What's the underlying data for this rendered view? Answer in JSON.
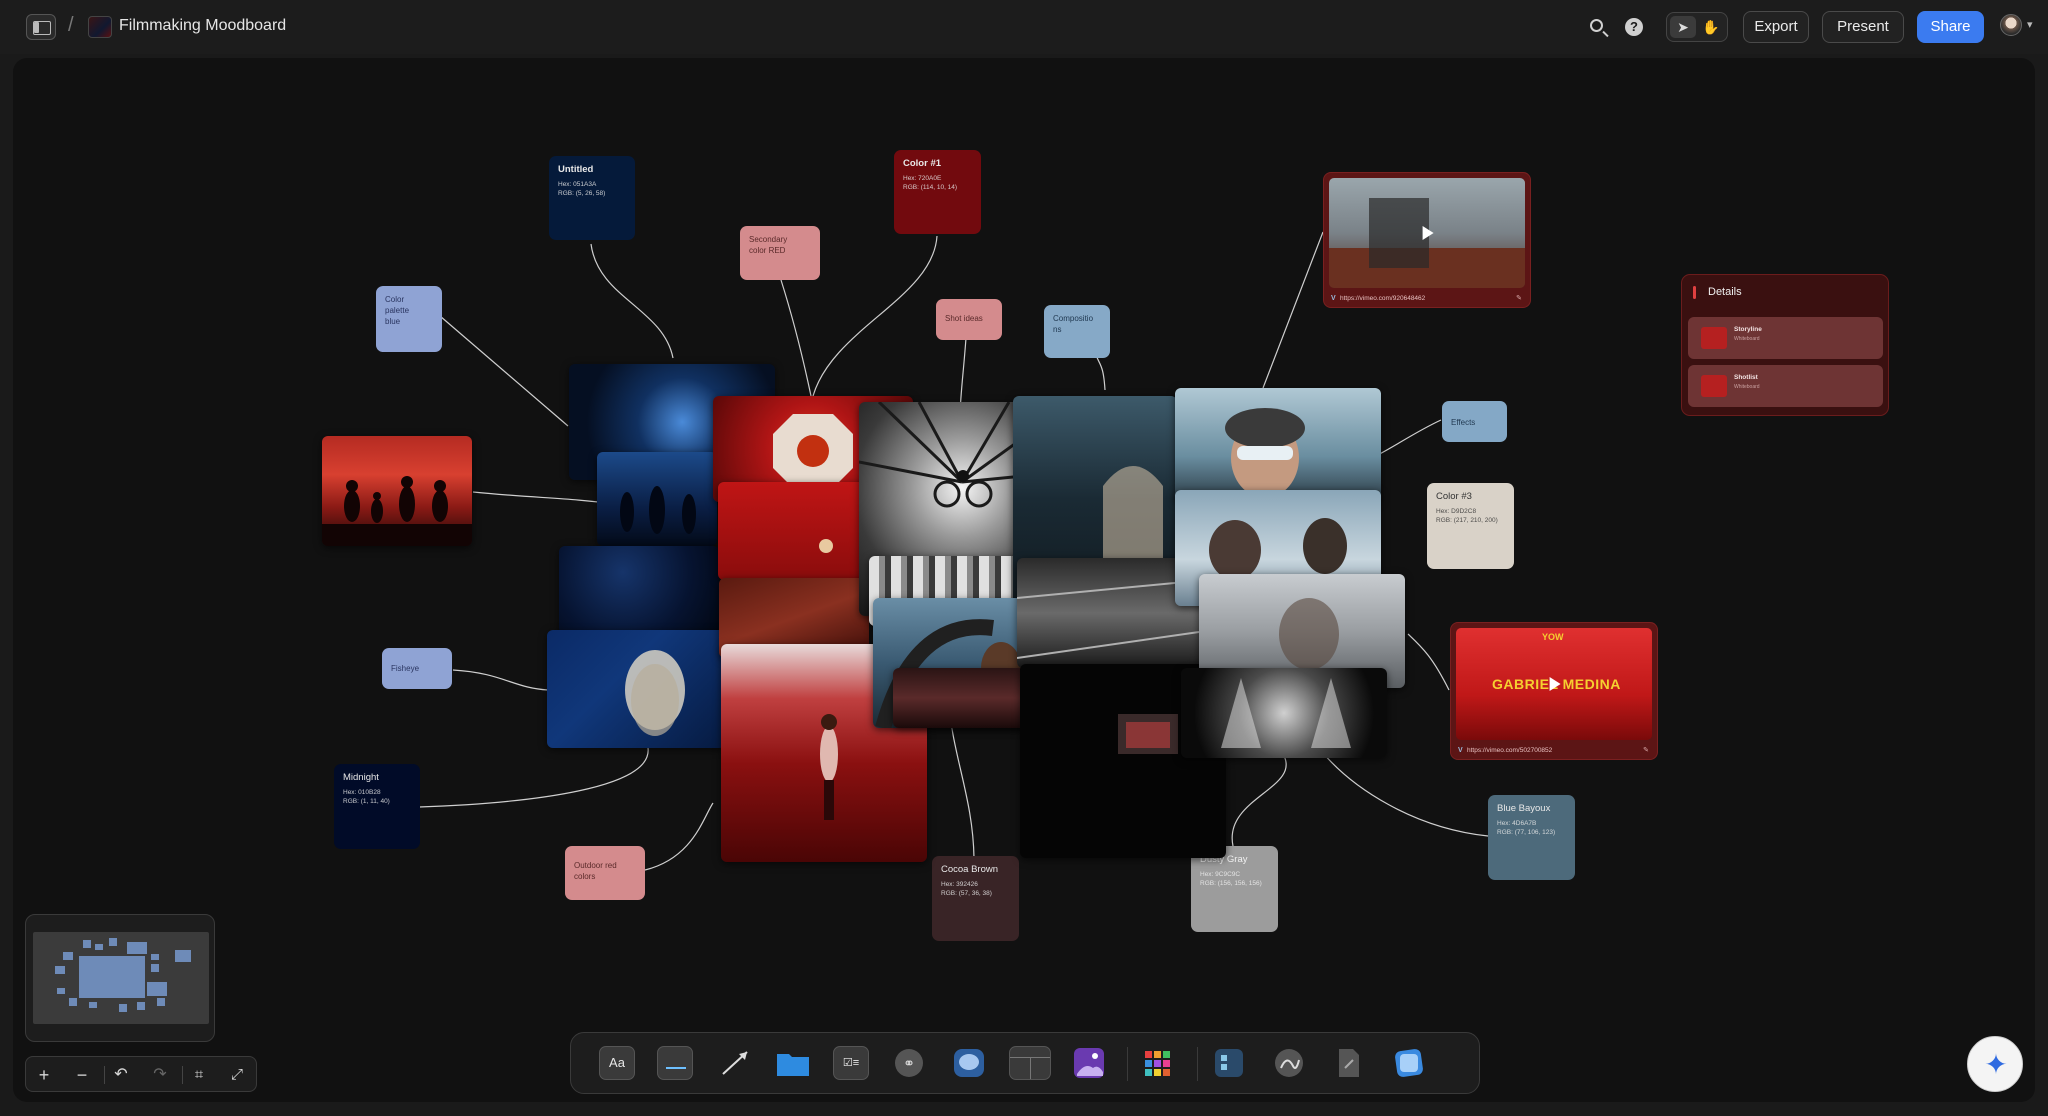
{
  "topbar": {
    "title": "Filmmaking Moodboard",
    "separator": "/",
    "export_label": "Export",
    "present_label": "Present",
    "share_label": "Share"
  },
  "notes": {
    "untitled": {
      "title": "Untitled",
      "hex": "Hex: 051A3A",
      "rgb": "RGB: (5, 26, 58)"
    },
    "color1": {
      "title": "Color #1",
      "hex": "Hex: 720A0E",
      "rgb": "RGB: (114, 10, 14)"
    },
    "secondary": {
      "text": "Secondary color RED"
    },
    "shot_ideas": {
      "text": "Shot ideas"
    },
    "compositions": {
      "text": "Compositions"
    },
    "palette_blue": {
      "text": "Color palette blue"
    },
    "effects": {
      "text": "Effects"
    },
    "color3": {
      "title": "Color #3",
      "hex": "Hex: D9D2C8",
      "rgb": "RGB: (217, 210, 200)"
    },
    "fisheye": {
      "text": "Fisheye"
    },
    "midnight": {
      "title": "Midnight",
      "hex": "Hex: 010B28",
      "rgb": "RGB: (1, 11, 40)"
    },
    "outdoor_red": {
      "text": "Outdoor red colors"
    },
    "cocoa": {
      "title": "Cocoa Brown",
      "hex": "Hex: 392426",
      "rgb": "RGB: (57, 36, 38)"
    },
    "dusty": {
      "title": "Dusty Gray",
      "hex": "Hex: 9C9C9C",
      "rgb": "RGB: (156, 156, 156)"
    },
    "bayoux": {
      "title": "Blue Bayoux",
      "hex": "Hex: 4D6A7B",
      "rgb": "RGB: (77, 106, 123)"
    }
  },
  "videos": {
    "video1": {
      "url": "https://vimeo.com/920648462"
    },
    "video2": {
      "url": "https://vimeo.com/502700852",
      "headline": "GABRIEL MEDINA",
      "top_text": "YOW"
    }
  },
  "details": {
    "title": "Details",
    "items": [
      {
        "label": "Storyline",
        "sub": "Whiteboard"
      },
      {
        "label": "Shotlist",
        "sub": "Whiteboard"
      }
    ]
  },
  "toolbar": {
    "text_tool_label": "Aa"
  },
  "icons": {
    "search": "search-icon",
    "help": "help-icon",
    "select": "cursor-icon",
    "hand": "hand-icon",
    "ai": "sparkle-icon"
  },
  "colors": {
    "accent": "#3b7bf0",
    "canvas": "#111111",
    "topbar": "#1c1c1c"
  }
}
